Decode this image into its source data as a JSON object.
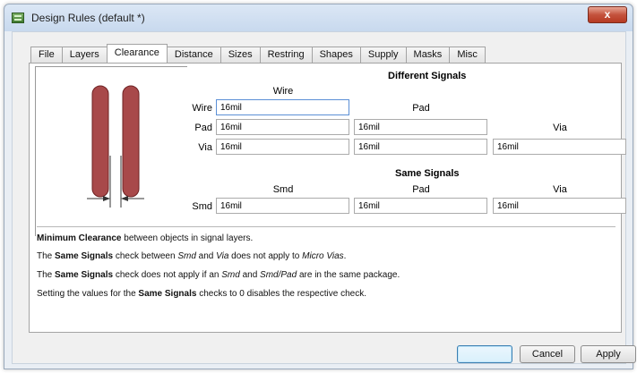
{
  "window": {
    "title": "Design Rules (default *)",
    "close_label": "x"
  },
  "tabs": [
    {
      "label": "File"
    },
    {
      "label": "Layers"
    },
    {
      "label": "Clearance",
      "active": true
    },
    {
      "label": "Distance"
    },
    {
      "label": "Sizes"
    },
    {
      "label": "Restring"
    },
    {
      "label": "Shapes"
    },
    {
      "label": "Supply"
    },
    {
      "label": "Masks"
    },
    {
      "label": "Misc"
    }
  ],
  "different_signals": {
    "heading": "Different Signals",
    "columns": {
      "wire": "Wire",
      "pad": "Pad",
      "via": "Via"
    },
    "rows": {
      "wire": {
        "label": "Wire",
        "wire": "16mil"
      },
      "pad": {
        "label": "Pad",
        "wire": "16mil",
        "pad": "16mil"
      },
      "via": {
        "label": "Via",
        "wire": "16mil",
        "pad": "16mil",
        "via": "16mil"
      }
    }
  },
  "same_signals": {
    "heading": "Same Signals",
    "columns": {
      "smd": "Smd",
      "pad": "Pad",
      "via": "Via"
    },
    "rows": {
      "smd": {
        "label": "Smd",
        "smd": "16mil",
        "pad": "16mil",
        "via": "16mil"
      }
    }
  },
  "info": {
    "line1": {
      "b1": "Minimum Clearance",
      "t1": " between objects in signal layers."
    },
    "line2": {
      "t1": "The ",
      "b1": "Same Signals",
      "t2": " check between ",
      "i1": "Smd",
      "t3": " and ",
      "i2": "Via",
      "t4": " does not apply to ",
      "i3": "Micro Vias",
      "t5": "."
    },
    "line3": {
      "t1": "The ",
      "b1": "Same Signals",
      "t2": " check does not apply if an ",
      "i1": "Smd",
      "t3": " and ",
      "i2": "Smd/Pad",
      "t4": " are in the same package."
    },
    "line4": {
      "t1": "Setting the values for the ",
      "b1": "Same Signals",
      "t2": " checks to 0 disables the respective check."
    }
  },
  "buttons": {
    "ok": "",
    "cancel": "Cancel",
    "apply": "Apply"
  },
  "colors": {
    "trace": "#a8494a",
    "trace_border": "#6e2223"
  }
}
